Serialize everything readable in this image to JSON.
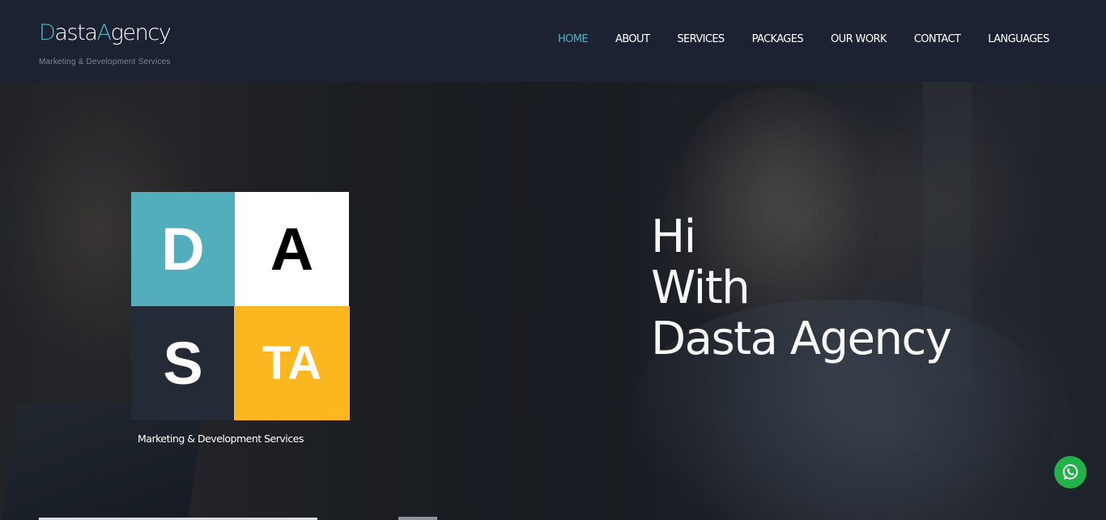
{
  "header": {
    "logo": {
      "part1_accent": "D",
      "part1": "asta",
      "part2_accent": "A",
      "part2": "gency"
    },
    "tagline": "Marketing & Development Services",
    "nav": [
      {
        "label": "HOME",
        "active": true
      },
      {
        "label": "ABOUT",
        "active": false
      },
      {
        "label": "SERVICES",
        "active": false
      },
      {
        "label": "PACKAGES",
        "active": false
      },
      {
        "label": "OUR WORK",
        "active": false
      },
      {
        "label": "CONTACT",
        "active": false
      },
      {
        "label": "LANGUAGES",
        "active": false
      }
    ]
  },
  "hero": {
    "tiles": {
      "d": "D",
      "a": "A",
      "s": "S",
      "ta": "TA"
    },
    "caption": "Marketing & Development Services",
    "headline": {
      "line1": "Hi",
      "line2": "With",
      "line3": "Dasta Agency"
    }
  },
  "whatsapp": {
    "icon": "whatsapp-icon"
  },
  "colors": {
    "accent": "#52b5c2",
    "header_bg": "#1c2231",
    "tile_teal": "#52aeba",
    "tile_yellow": "#fbb620",
    "tile_dark": "#242a36",
    "whatsapp_green": "#23b14a"
  }
}
